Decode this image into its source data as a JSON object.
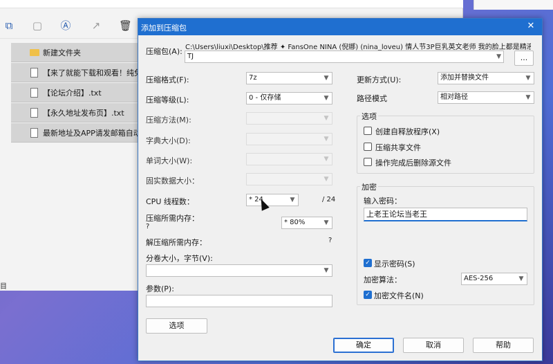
{
  "explorer": {
    "files": [
      {
        "name": "新建文件夹",
        "type": "folder"
      },
      {
        "name": "【来了就能下载和观看！纯免费",
        "type": "file"
      },
      {
        "name": "【论坛介绍】.txt",
        "type": "file"
      },
      {
        "name": "【永久地址发布页】.txt",
        "type": "file"
      },
      {
        "name": "最新地址及APP请发邮箱自动",
        "type": "file"
      }
    ],
    "footer_text": "目"
  },
  "dialog": {
    "title": "添加到压缩包",
    "archive_label": "压缩包(A):",
    "archive_path": "C:\\Users\\liuxi\\Desktop\\推荐 ✦ FansOne NINA (倪娜) (nina_loveu) 情人节3P巨乳英文老师 我的脸上都是精液\\",
    "archive_name": "TJ",
    "browse_label": "...",
    "left": {
      "format_label": "压缩格式(F):",
      "format_value": "7z",
      "level_label": "压缩等级(L):",
      "level_value": "0 - 仅存储",
      "method_label": "压缩方法(M):",
      "dict_label": "字典大小(D):",
      "word_label": "单词大小(W):",
      "solid_label": "固实数据大小：",
      "cpu_label": "CPU 线程数：",
      "cpu_value": "* 24",
      "cpu_max": "/ 24",
      "mem_comp_label": "压缩所需内存：",
      "mem_comp_value": "?",
      "mem_percent": "* 80%",
      "mem_decomp_label": "解压缩所需内存：",
      "mem_decomp_value": "?",
      "volume_label": "分卷大小，字节(V):",
      "params_label": "参数(P):",
      "options_btn": "选项"
    },
    "right": {
      "update_label": "更新方式(U):",
      "update_value": "添加并替换文件",
      "path_label": "路径模式",
      "path_value": "相对路径",
      "options_group": "选项",
      "opt_sfx": "创建自释放程序(X)",
      "opt_shared": "压缩共享文件",
      "opt_delete": "操作完成后删除源文件",
      "encrypt_group": "加密",
      "password_label": "输入密码：",
      "password_value": "上老王论坛当老王",
      "show_password": "显示密码(S)",
      "algo_label": "加密算法：",
      "algo_value": "AES-256",
      "encrypt_names": "加密文件名(N)"
    },
    "buttons": {
      "ok": "确定",
      "cancel": "取消",
      "help": "帮助"
    }
  },
  "icons": {
    "close": "close-icon",
    "checkmark": "✓",
    "arrow": "▼"
  }
}
